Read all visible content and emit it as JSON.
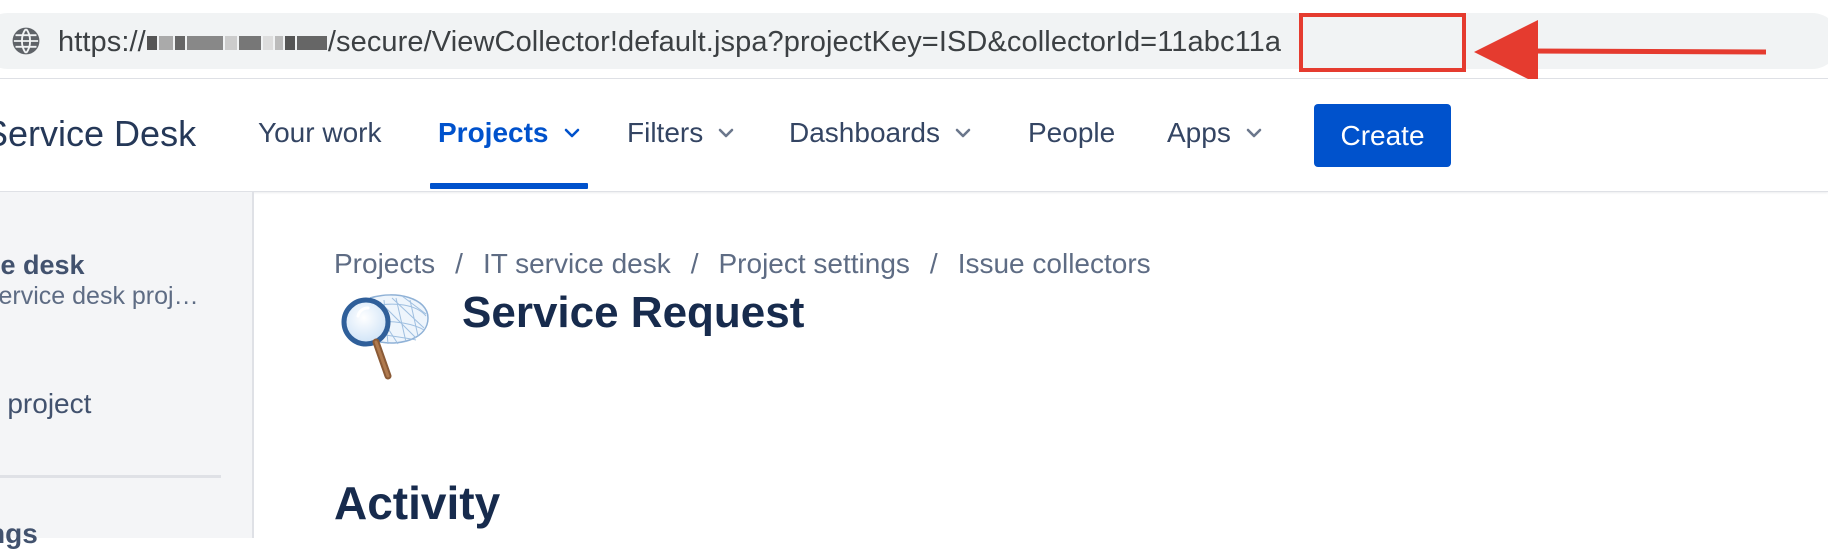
{
  "browser": {
    "url_prefix": "https://",
    "url_path": "/secure/ViewCollector!default.jspa?projectKey=ISD&collectorId=",
    "url_highlighted": "11abc11a",
    "annotation_color": "#e53b2f"
  },
  "nav": {
    "product_name": "Service Desk",
    "items": [
      {
        "label": "Your work"
      },
      {
        "label": "Projects"
      },
      {
        "label": "Filters"
      },
      {
        "label": "Dashboards"
      },
      {
        "label": "People"
      },
      {
        "label": "Apps"
      }
    ],
    "active_item": "Projects",
    "create_label": "Create",
    "accent_color": "#0052cc"
  },
  "sidebar": {
    "project_name": "ice desk",
    "project_type": "service desk proj…",
    "link_label": "o project",
    "settings_label": "ngs"
  },
  "breadcrumb": [
    "Projects",
    "IT service desk",
    "Project settings",
    "Issue collectors"
  ],
  "breadcrumb_separator": "/",
  "page": {
    "title": "Service Request",
    "section_heading": "Activity"
  },
  "icons": {
    "address_bar": "globe-icon",
    "collector": "bug-net-magnifier-icon",
    "annotation": "red-arrow"
  }
}
